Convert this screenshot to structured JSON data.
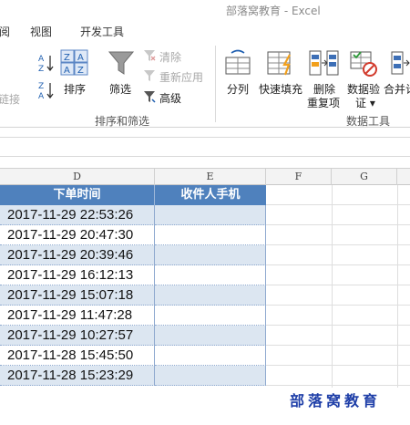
{
  "window": {
    "title": "部落窝教育 - Excel"
  },
  "tabs": [
    {
      "label": "阅"
    },
    {
      "label": "视图"
    },
    {
      "label": "开发工具"
    }
  ],
  "ribbon": {
    "partial_left": "链接",
    "sort_asc_icon": "sort-a-z-icon",
    "sort_desc_icon": "sort-z-a-icon",
    "sort": {
      "label": "排序"
    },
    "filter": {
      "label": "筛选"
    },
    "clear": {
      "label": "清除"
    },
    "reapply": {
      "label": "重新应用"
    },
    "advanced": {
      "label": "高级"
    },
    "sort_filter_group": "排序和筛选",
    "text_to_columns": {
      "label": "分列"
    },
    "flash_fill": {
      "label": "快速填充"
    },
    "remove_dup": {
      "label_1": "删除",
      "label_2": "重复项"
    },
    "validation": {
      "label_1": "数据验",
      "label_2": "证 ▾"
    },
    "consolidate": {
      "label": "合并计"
    },
    "data_tools_group": "数据工具"
  },
  "grid": {
    "columns": [
      "D",
      "E",
      "F",
      "G"
    ],
    "headers": {
      "order_time": "下单时间",
      "phone": "收件人手机"
    },
    "rows": [
      "2017-11-29 22:53:26",
      "2017-11-29 20:47:30",
      "2017-11-29 20:39:46",
      "2017-11-29 16:12:13",
      "2017-11-29 15:07:18",
      "2017-11-29 11:47:28",
      "2017-11-29 10:27:57",
      "2017-11-28 15:45:50",
      "2017-11-28 15:23:29"
    ]
  },
  "watermark": "部落窝教育",
  "colors": {
    "header_blue": "#4f81bd",
    "band_blue": "#dce6f1",
    "watermark": "#1f3fa8"
  }
}
